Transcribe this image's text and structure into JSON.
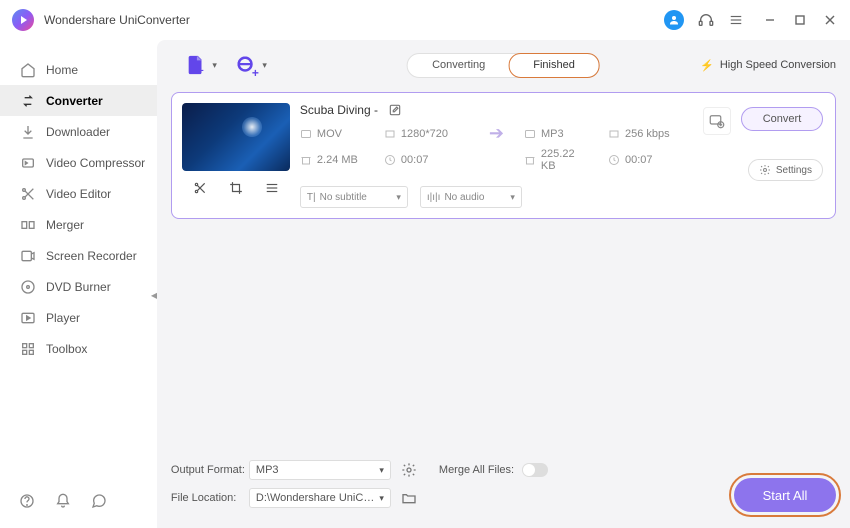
{
  "app": {
    "title": "Wondershare UniConverter"
  },
  "sidebar": {
    "items": [
      {
        "label": "Home",
        "icon": "home"
      },
      {
        "label": "Converter",
        "icon": "converter",
        "active": true
      },
      {
        "label": "Downloader",
        "icon": "downloader"
      },
      {
        "label": "Video Compressor",
        "icon": "compressor"
      },
      {
        "label": "Video Editor",
        "icon": "editor"
      },
      {
        "label": "Merger",
        "icon": "merger"
      },
      {
        "label": "Screen Recorder",
        "icon": "recorder"
      },
      {
        "label": "DVD Burner",
        "icon": "dvd"
      },
      {
        "label": "Player",
        "icon": "player"
      },
      {
        "label": "Toolbox",
        "icon": "toolbox"
      }
    ]
  },
  "tabs": {
    "converting": "Converting",
    "finished": "Finished",
    "active": "finished"
  },
  "toolbar": {
    "high_speed": "High Speed Conversion"
  },
  "file": {
    "title": "Scuba Diving -",
    "source": {
      "format": "MOV",
      "resolution": "1280*720",
      "size": "2.24 MB",
      "duration": "00:07"
    },
    "target": {
      "format": "MP3",
      "bitrate": "256 kbps",
      "size": "225.22 KB",
      "duration": "00:07"
    },
    "subtitle_select": "No subtitle",
    "audio_select": "No audio",
    "convert_btn": "Convert",
    "settings_btn": "Settings"
  },
  "bottom": {
    "output_format_label": "Output Format:",
    "output_format_value": "MP3",
    "file_location_label": "File Location:",
    "file_location_value": "D:\\Wondershare UniConverter",
    "merge_label": "Merge All Files:",
    "start_all": "Start All"
  }
}
